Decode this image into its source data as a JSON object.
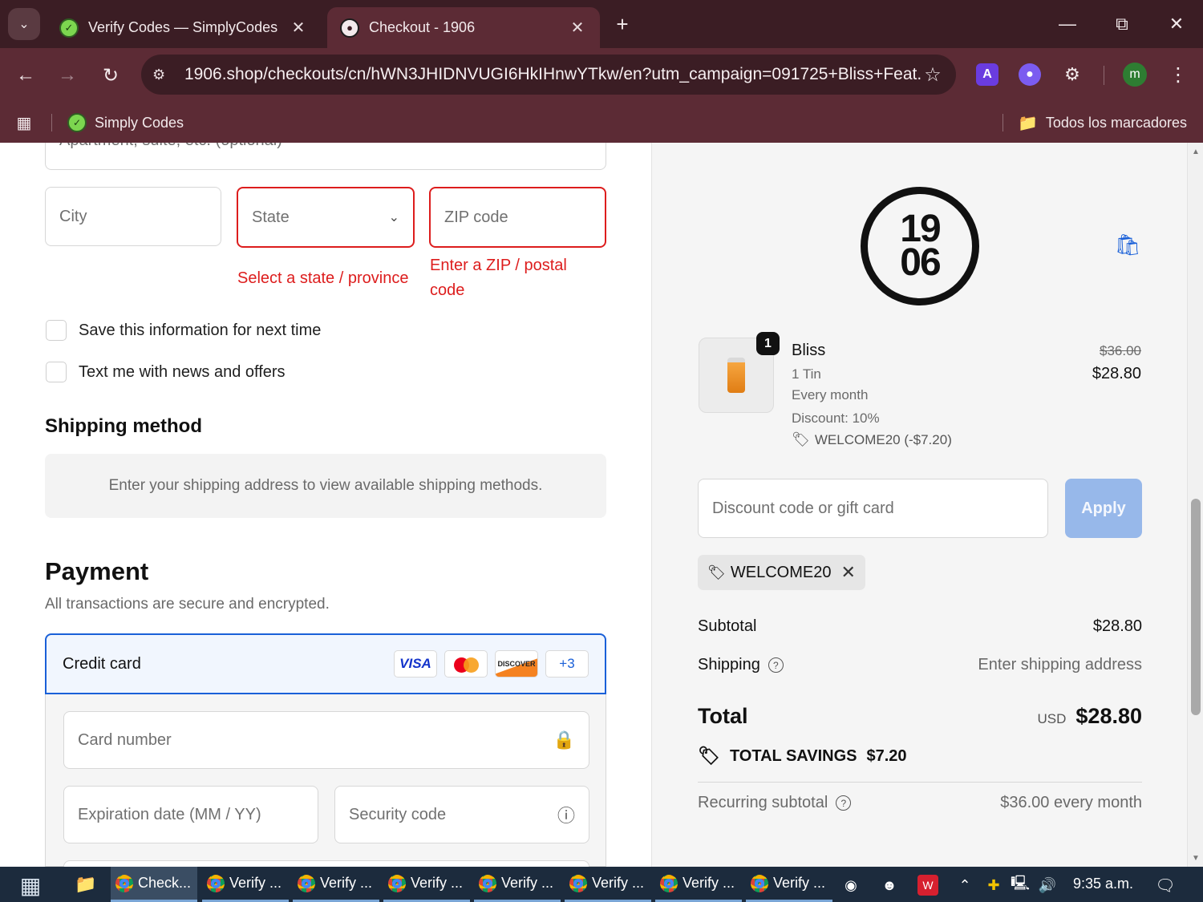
{
  "browser": {
    "tabs": [
      {
        "title": "Verify Codes — SimplyCodes",
        "favicon": "simplycodes-icon"
      },
      {
        "title": "Checkout - 1906",
        "favicon": "1906-logo-icon",
        "active": true
      }
    ],
    "url": "1906.shop/checkouts/cn/hWN3JHIDNVUGI6HkIHnwYTkw/en?utm_campaign=091725+Bliss+Feat...",
    "bookmarks": [
      {
        "label": "Simply Codes"
      }
    ],
    "all_bookmarks_label": "Todos los marcadores",
    "profile_initial": "m",
    "extension_a": "A"
  },
  "form": {
    "address2_placeholder": "Apartment, suite, etc. (optional)",
    "city_placeholder": "City",
    "state_placeholder": "State",
    "zip_placeholder": "ZIP code",
    "state_error": "Select a state / province",
    "zip_error_line1": "Enter a ZIP / postal",
    "zip_error_line2": "code",
    "save_info_label": "Save this information for next time",
    "text_me_label": "Text me with news and offers"
  },
  "shipping": {
    "heading": "Shipping method",
    "placeholder_text": "Enter your shipping address to view available shipping methods."
  },
  "payment": {
    "heading": "Payment",
    "subtitle": "All transactions are secure and encrypted.",
    "method_label": "Credit card",
    "brands": {
      "visa": "VISA",
      "discover": "DISCOVER",
      "more": "+3"
    },
    "card_number_placeholder": "Card number",
    "expiry_placeholder": "Expiration date (MM / YY)",
    "security_placeholder": "Security code"
  },
  "summary": {
    "logo_top": "19",
    "logo_bottom": "06",
    "product": {
      "quantity": "1",
      "name": "Bliss",
      "variant": "1 Tin",
      "frequency": "Every month",
      "discount": "Discount: 10%",
      "code_applied": "WELCOME20 (-$7.20)",
      "price_original": "$36.00",
      "price_final": "$28.80"
    },
    "discount_placeholder": "Discount code or gift card",
    "apply_label": "Apply",
    "chip_code": "WELCOME20",
    "subtotal_label": "Subtotal",
    "subtotal_value": "$28.80",
    "shipping_label": "Shipping",
    "shipping_value": "Enter shipping address",
    "total_label": "Total",
    "currency": "USD",
    "total_value": "$28.80",
    "savings_label": "TOTAL SAVINGS",
    "savings_value": "$7.20",
    "recurring_label": "Recurring subtotal",
    "recurring_value": "$36.00 every month"
  },
  "taskbar": {
    "items": [
      "Check...",
      "Verify ...",
      "Verify ...",
      "Verify ...",
      "Verify ...",
      "Verify ...",
      "Verify ...",
      "Verify ..."
    ],
    "clock": "9:35 a.m."
  },
  "colors": {
    "accent": "#1a60d8",
    "error": "#dd1d1d",
    "chrome_frame": "#5c2b35"
  }
}
